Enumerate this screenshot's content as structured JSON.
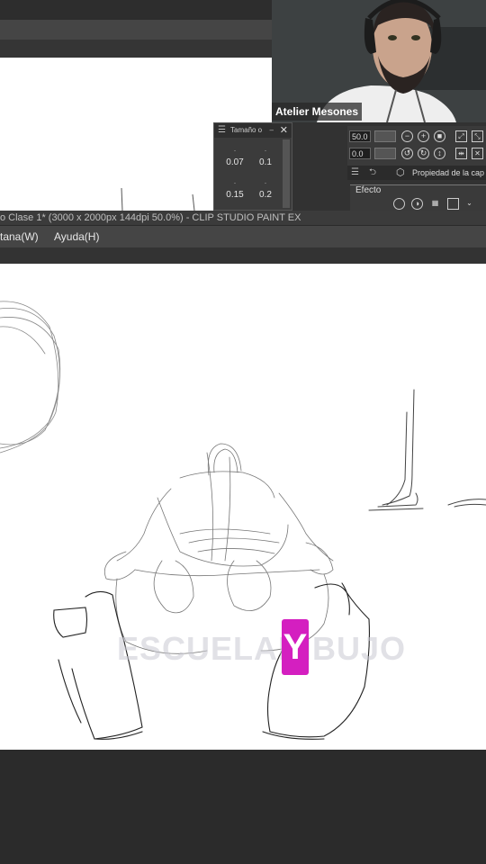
{
  "webcam": {
    "streamer_name": "Atelier Mesones"
  },
  "size_panel": {
    "title": "Tamaño o",
    "values": [
      "0.07",
      "0.1",
      "0.15",
      "0.2"
    ]
  },
  "tool_property": {
    "value1": "50.0",
    "value2": "0.0",
    "title": "Propiedad de la cap",
    "effect_label": "Efecto"
  },
  "window": {
    "title": "o Clase 1* (3000 x 2000px 144dpi 50.0%)  - CLIP STUDIO PAINT EX"
  },
  "menu": {
    "items": [
      "tana(W)",
      "Ayuda(H)"
    ]
  },
  "watermark": {
    "letter": "Y"
  },
  "colors": {
    "accent_watermark": "#d41fc0",
    "ui_dark": "#2b2b2b",
    "canvas": "#ffffff"
  }
}
